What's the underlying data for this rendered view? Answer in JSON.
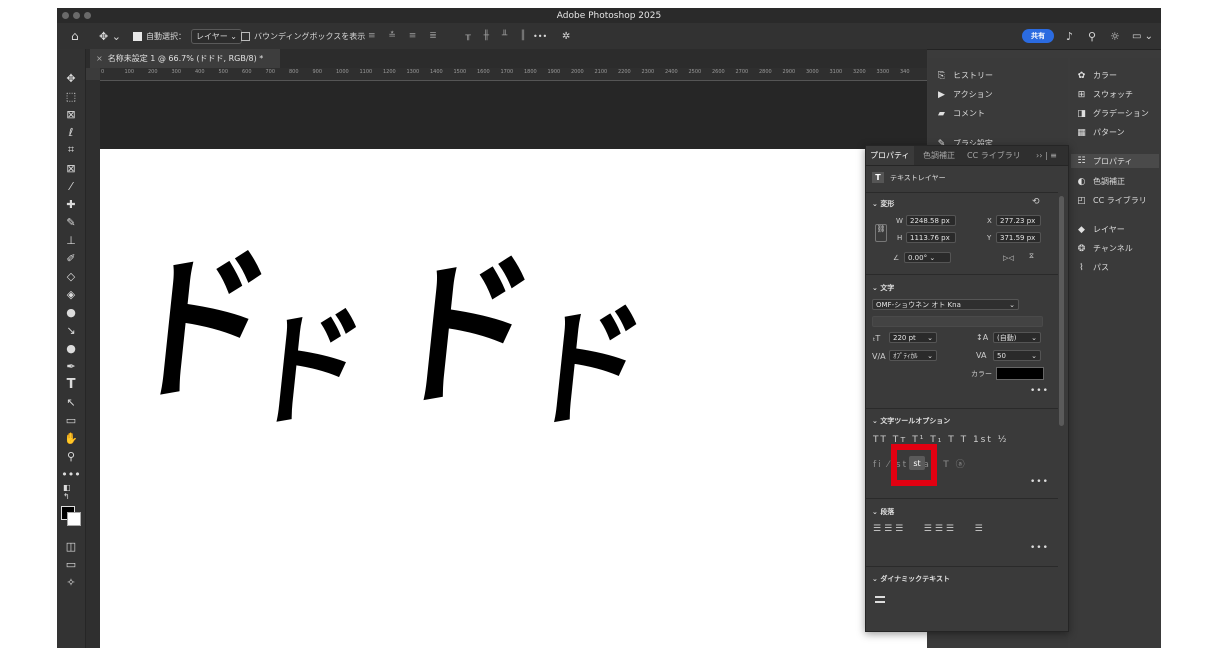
{
  "window": {
    "title": "Adobe Photoshop 2025"
  },
  "options_bar": {
    "auto_select_label": "自動選択：",
    "auto_select_target": "レイヤー",
    "bounding_box_label": "バウンディングボックスを表示",
    "more_label": "•••",
    "share_label": "共有"
  },
  "document": {
    "tab_title": "名称未設定 1 @ 66.7% (ドドド, RGB/8) *",
    "canvas_text": [
      "ド",
      "ド",
      "ド",
      "ド"
    ]
  },
  "ruler": {
    "ticks": [
      "0",
      "100",
      "200",
      "300",
      "400",
      "500",
      "600",
      "700",
      "800",
      "900",
      "1000",
      "1100",
      "1200",
      "1300",
      "1400",
      "1500",
      "1600",
      "1700",
      "1800",
      "1900",
      "2000",
      "2100",
      "2200",
      "2300",
      "2400",
      "2500",
      "2600",
      "2700",
      "2800",
      "2900",
      "3000",
      "3100",
      "3200",
      "3300",
      "340"
    ]
  },
  "dock_mid": {
    "items": [
      "ヒストリー",
      "アクション",
      "コメント",
      "ブラシ設定"
    ]
  },
  "dock_right": {
    "items": [
      "カラー",
      "スウォッチ",
      "グラデーション",
      "パターン",
      "プロパティ",
      "色調補正",
      "CC ライブラリ",
      "レイヤー",
      "チャンネル",
      "パス"
    ]
  },
  "properties": {
    "tabs": [
      "プロパティ",
      "色調補正",
      "CC ライブラリ"
    ],
    "layer_type": "テキストレイヤー",
    "transform": {
      "title": "変形",
      "w_label": "W",
      "w": "2248.58 px",
      "h_label": "H",
      "h": "1113.76 px",
      "x_label": "X",
      "x": "277.23 px",
      "y_label": "Y",
      "y": "371.59 px",
      "angle": "0.00°"
    },
    "character": {
      "title": "文字",
      "font": "OMF-ショウネン オト Kna",
      "size": "220 pt",
      "leading": "(自動)",
      "kerning": "ｵﾌﾟﾃｨｶﾙ",
      "tracking": "50",
      "color_label": "カラー",
      "color": "#000000"
    },
    "type_options": {
      "title": "文字ツールオプション",
      "row1": "TT Tᴛ T¹ T₁ T T 1st ½",
      "st": "st",
      "row2": "fi ⁄ st ₐ aa T ⓐ"
    },
    "paragraph": {
      "title": "段落"
    },
    "dynamic_text": {
      "title": "ダイナミックテキスト"
    },
    "more": "•••"
  }
}
